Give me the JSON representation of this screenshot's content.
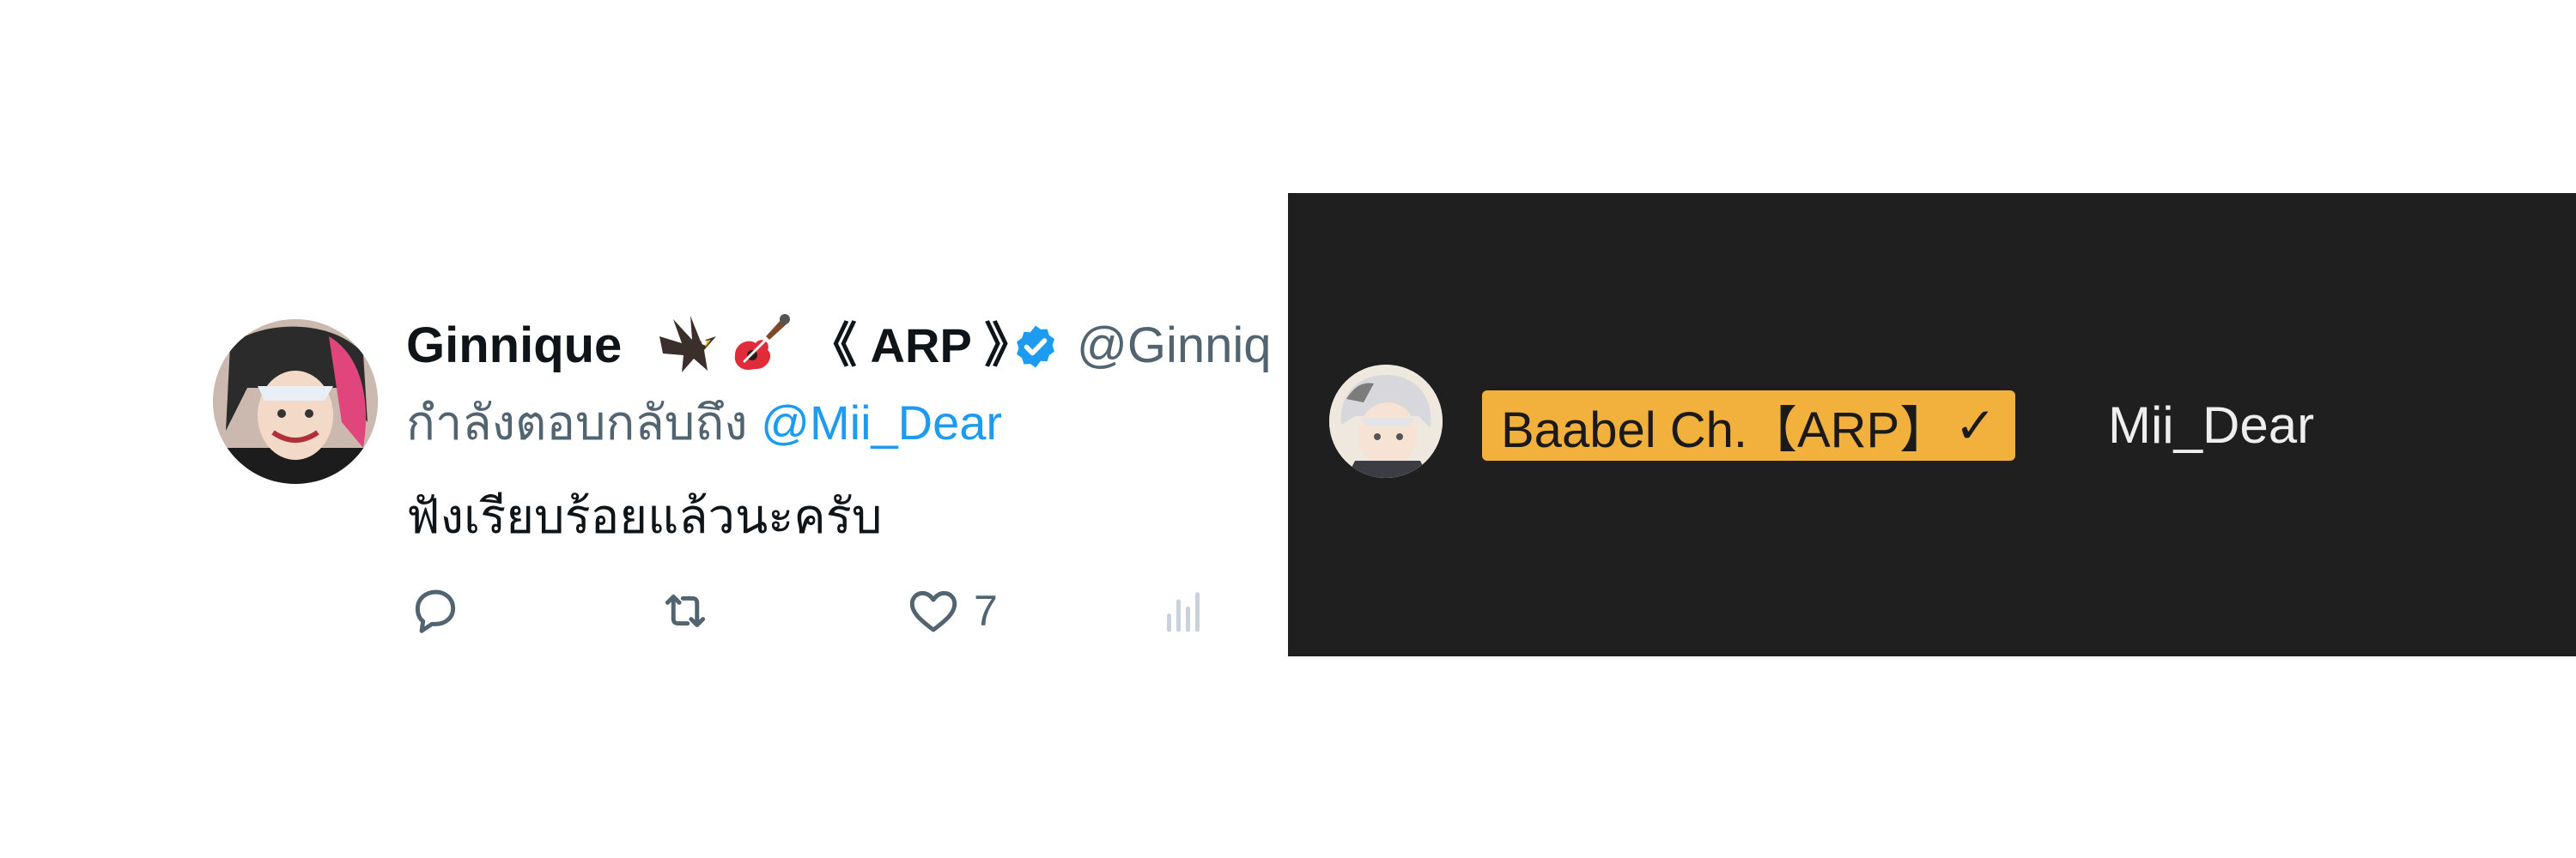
{
  "tweet": {
    "display_name": "Ginnique",
    "name_tag": "《 ARP 》",
    "name_emojis": [
      "eagle-icon",
      "guitar-icon"
    ],
    "handle": "@Ginniq",
    "replying_prefix": "กำลังตอบกลับถึง",
    "replying_to": "@Mii_Dear",
    "text": "ฟังเรียบร้อยแล้วนะครับ",
    "actions": {
      "reply_icon": "reply-icon",
      "retweet_icon": "retweet-icon",
      "like_icon": "heart-icon",
      "like_count": "7",
      "analytics_icon": "analytics-icon"
    },
    "colors": {
      "mention": "#1d9bf0",
      "verified": "#1d9bf0",
      "secondary_text": "#536471"
    }
  },
  "chat": {
    "badge_name": "Baabel Ch.【ARP】",
    "badge_check": "✓",
    "username": "Mii_Dear",
    "colors": {
      "background": "#1f1f1f",
      "badge": "#f2b13c"
    }
  }
}
